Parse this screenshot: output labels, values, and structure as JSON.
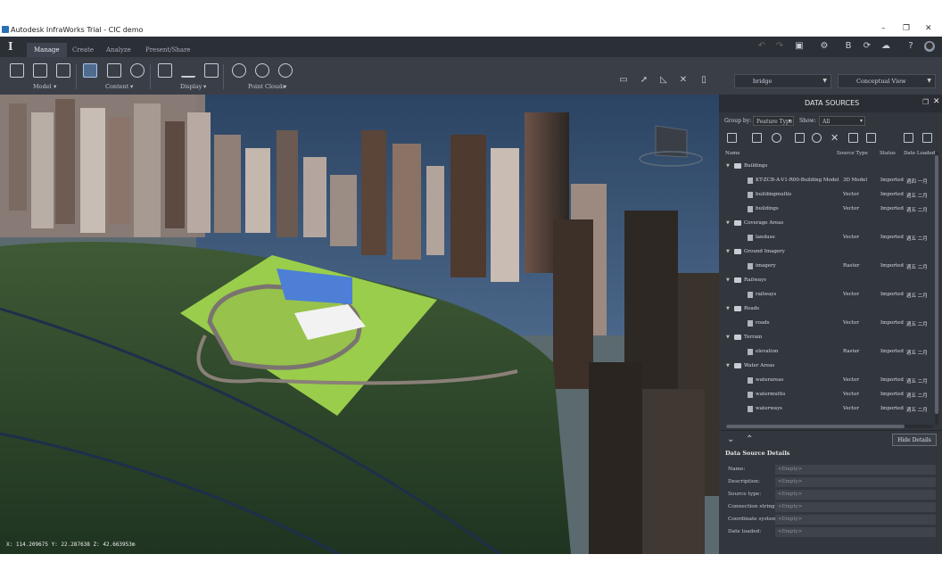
{
  "window": {
    "title": "Autodesk InfraWorks Trial - CIC demo",
    "controls": [
      "–",
      "❐",
      "✕"
    ]
  },
  "menu": {
    "logo": "I",
    "tabs": [
      "Manage",
      "Create",
      "Analyze",
      "Present/Share"
    ],
    "active_tab": "Manage"
  },
  "ribbon": {
    "groups": [
      "Model",
      "Content",
      "Display",
      "Point Clouds"
    ],
    "search_box": "bridge",
    "view_select": "Conceptual View"
  },
  "viewport": {
    "coordinates": "X: 114.209675 Y: 22.287638 Z: 42.663953m"
  },
  "panel": {
    "title": "DATA SOURCES",
    "group_by_label": "Group by:",
    "group_by_value": "Feature Type",
    "show_label": "Show:",
    "show_value": "All",
    "columns": [
      "Name",
      "Source Type",
      "Status",
      "Date Loaded"
    ],
    "rows": [
      {
        "group": true,
        "name": "Buildings"
      },
      {
        "name": "KT-ZCB-A-V1-R00-Building Model",
        "type": "3D Model",
        "status": "Imported",
        "date": "週四 一月"
      },
      {
        "name": "buildingmultis",
        "type": "Vector",
        "status": "Imported",
        "date": "週五 二月"
      },
      {
        "name": "buildings",
        "type": "Vector",
        "status": "Imported",
        "date": "週五 二月"
      },
      {
        "group": true,
        "name": "Coverage Areas"
      },
      {
        "name": "landuse",
        "type": "Vector",
        "status": "Imported",
        "date": "週五 二月"
      },
      {
        "group": true,
        "name": "Ground Imagery"
      },
      {
        "name": "imagery",
        "type": "Raster",
        "status": "Imported",
        "date": "週五 二月"
      },
      {
        "group": true,
        "name": "Railways"
      },
      {
        "name": "railways",
        "type": "Vector",
        "status": "Imported",
        "date": "週五 二月"
      },
      {
        "group": true,
        "name": "Roads"
      },
      {
        "name": "roads",
        "type": "Vector",
        "status": "Imported",
        "date": "週五 二月"
      },
      {
        "group": true,
        "name": "Terrain"
      },
      {
        "name": "elevation",
        "type": "Raster",
        "status": "Imported",
        "date": "週五 二月"
      },
      {
        "group": true,
        "name": "Water Areas"
      },
      {
        "name": "waterareas",
        "type": "Vector",
        "status": "Imported",
        "date": "週五 二月"
      },
      {
        "name": "watermultis",
        "type": "Vector",
        "status": "Imported",
        "date": "週五 二月"
      },
      {
        "name": "waterways",
        "type": "Vector",
        "status": "Imported",
        "date": "週五 二月"
      }
    ],
    "hide_details_button": "Hide Details",
    "details_title": "Data Source Details",
    "details": [
      {
        "label": "Name:",
        "value": "<Empty>"
      },
      {
        "label": "Description:",
        "value": "<Empty>"
      },
      {
        "label": "Source type:",
        "value": "<Empty>"
      },
      {
        "label": "Connection string:",
        "value": "<Empty>"
      },
      {
        "label": "Coordinate system:",
        "value": "<Empty>"
      },
      {
        "label": "Date loaded:",
        "value": "<Empty>"
      }
    ]
  }
}
